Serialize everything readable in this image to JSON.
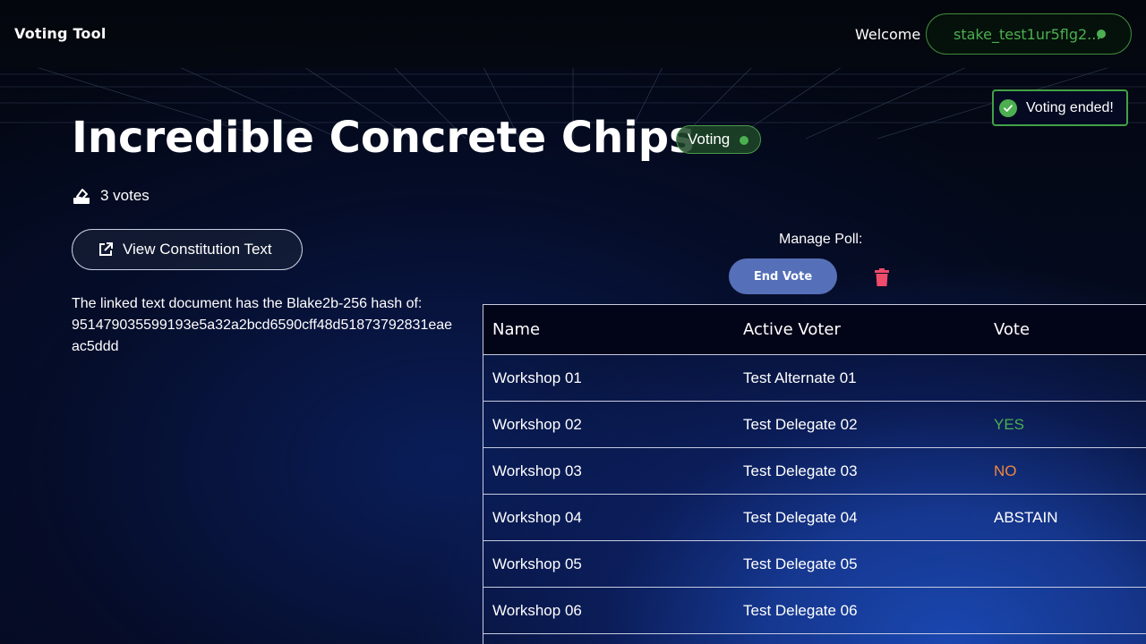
{
  "header": {
    "brand": "Voting Tool",
    "welcome": "Welcome",
    "wallet_address": "stake_test1ur5flg2...",
    "wallet_status_color": "#4caf50"
  },
  "toast": {
    "message": "Voting ended!",
    "icon": "check-circle-icon"
  },
  "poll": {
    "title": "Incredible Concrete Chips",
    "status": "Voting",
    "votes_label": "3 votes",
    "constitution_button": "View Constitution Text",
    "hash_lines": [
      "The linked text document has the Blake2b-256 hash of:",
      "951479035599193e5a32a2bcd6590cff48d51873792831eae",
      "ac5ddd"
    ]
  },
  "manage": {
    "label": "Manage Poll:",
    "end_vote_label": "End Vote",
    "delete_icon": "trash-icon"
  },
  "table": {
    "headers": [
      "Name",
      "Active Voter",
      "Vote"
    ],
    "rows": [
      {
        "name": "Workshop 01",
        "voter": "Test Alternate 01",
        "vote": "",
        "color": "#ffffff"
      },
      {
        "name": "Workshop 02",
        "voter": "Test Delegate 02",
        "vote": "YES",
        "color": "#4caf50"
      },
      {
        "name": "Workshop 03",
        "voter": "Test Delegate 03",
        "vote": "NO",
        "color": "#f0883e"
      },
      {
        "name": "Workshop 04",
        "voter": "Test Delegate 04",
        "vote": "ABSTAIN",
        "color": "#ffffff"
      },
      {
        "name": "Workshop 05",
        "voter": "Test Delegate 05",
        "vote": "",
        "color": "#ffffff"
      },
      {
        "name": "Workshop 06",
        "voter": "Test Delegate 06",
        "vote": "",
        "color": "#ffffff"
      }
    ]
  },
  "colors": {
    "accent_green": "#4caf50",
    "button_blue": "#5570b8",
    "delete_red": "#ef4b6a"
  }
}
